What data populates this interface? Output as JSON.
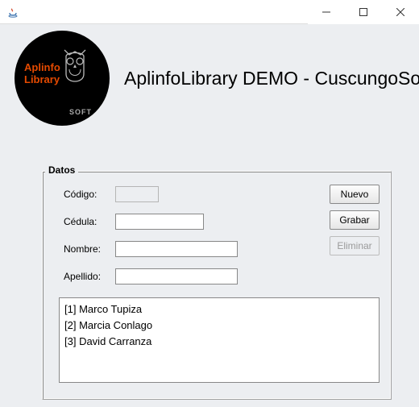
{
  "window": {
    "title": ""
  },
  "header": {
    "logo": {
      "line1": "Aplinfo",
      "line2": "Library",
      "brand": "SOFT"
    },
    "app_title": "AplinfoLibrary DEMO - CuscungoSoft"
  },
  "group": {
    "label": "Datos",
    "fields": {
      "codigo": {
        "label": "Código:",
        "value": ""
      },
      "cedula": {
        "label": "Cédula:",
        "value": ""
      },
      "nombre": {
        "label": "Nombre:",
        "value": ""
      },
      "apellido": {
        "label": "Apellido:",
        "value": ""
      }
    },
    "buttons": {
      "nuevo": "Nuevo",
      "grabar": "Grabar",
      "eliminar": "Eliminar"
    },
    "list": [
      "[1] Marco Tupiza",
      "[2] Marcia Conlago",
      "[3] David Carranza"
    ]
  }
}
